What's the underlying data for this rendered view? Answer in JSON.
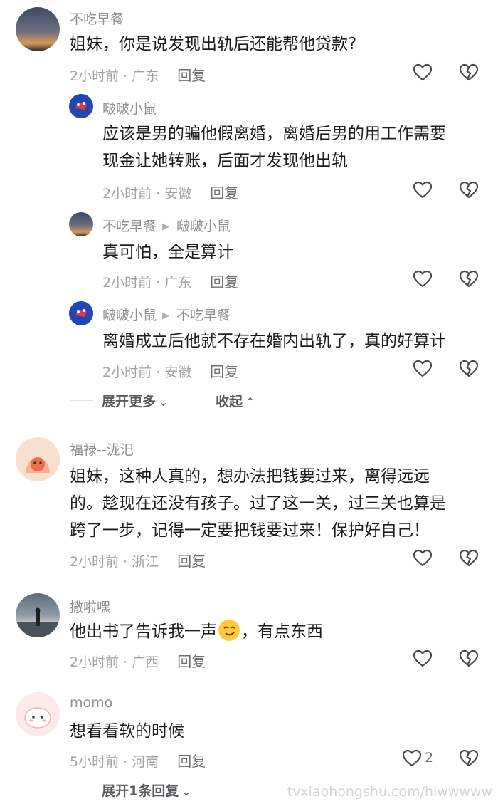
{
  "comments": [
    {
      "user": "不吃早餐",
      "text": "姐妹，你是说发现出轨后还能帮他贷款?",
      "time": "2小时前 · 广东",
      "reply_label": "回复",
      "replies": [
        {
          "user": "啵啵小鼠",
          "text_lines": [
            "应该是男的骗他假离婚，离婚后男的用工作需要",
            "现金让她转账，后面才发现他出轨"
          ],
          "time": "2小时前 · 安徽",
          "reply_label": "回复"
        },
        {
          "user": "不吃早餐",
          "reply_to": "啵啵小鼠",
          "text": "真可怕，全是算计",
          "time": "2小时前 · 广东",
          "reply_label": "回复"
        },
        {
          "user": "啵啵小鼠",
          "reply_to": "不吃早餐",
          "text": "离婚成立后他就不存在婚内出轨了，真的好算计",
          "time": "2小时前 · 安徽",
          "reply_label": "回复"
        }
      ],
      "expand_more": "展开更多",
      "collapse": "收起"
    },
    {
      "user": "福禄--泷汜",
      "text_lines": [
        "姐妹，这种人真的，想办法把钱要过来，离得远远",
        "的。趁现在还没有孩子。过了这一关，过三关也算是",
        "跨了一步，记得一定要把钱要过来！保护好自己！"
      ],
      "time": "2小时前 · 浙江",
      "reply_label": "回复"
    },
    {
      "user": "撒啦嘿",
      "text_before": "他出书了告诉我一声",
      "text_after": "，有点东西",
      "time": "2小时前 · 广西",
      "reply_label": "回复"
    },
    {
      "user": "momo",
      "text": "想看看软的时候",
      "time": "5小时前 · 河南",
      "reply_label": "回复",
      "likes": "2",
      "expand_replies": "展开1条回复"
    }
  ],
  "icons": {
    "like": "heart-outline-icon",
    "dislike": "broken-heart-icon",
    "emoji": "grinning-smirk-emoji"
  },
  "watermark": "tvxiaohongshu.com/hiwwwww"
}
